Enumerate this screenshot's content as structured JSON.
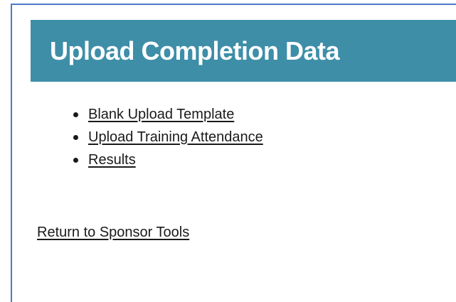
{
  "header": {
    "title": "Upload Completion Data"
  },
  "links": [
    {
      "label": "Blank Upload Template"
    },
    {
      "label": "Upload Training Attendance"
    },
    {
      "label": "Results"
    }
  ],
  "footer": {
    "return_label": "Return to Sponsor Tools"
  },
  "colors": {
    "header_background": "#3e8ea8",
    "frame_border": "#4d77c9",
    "text": "#1a1a1a"
  }
}
